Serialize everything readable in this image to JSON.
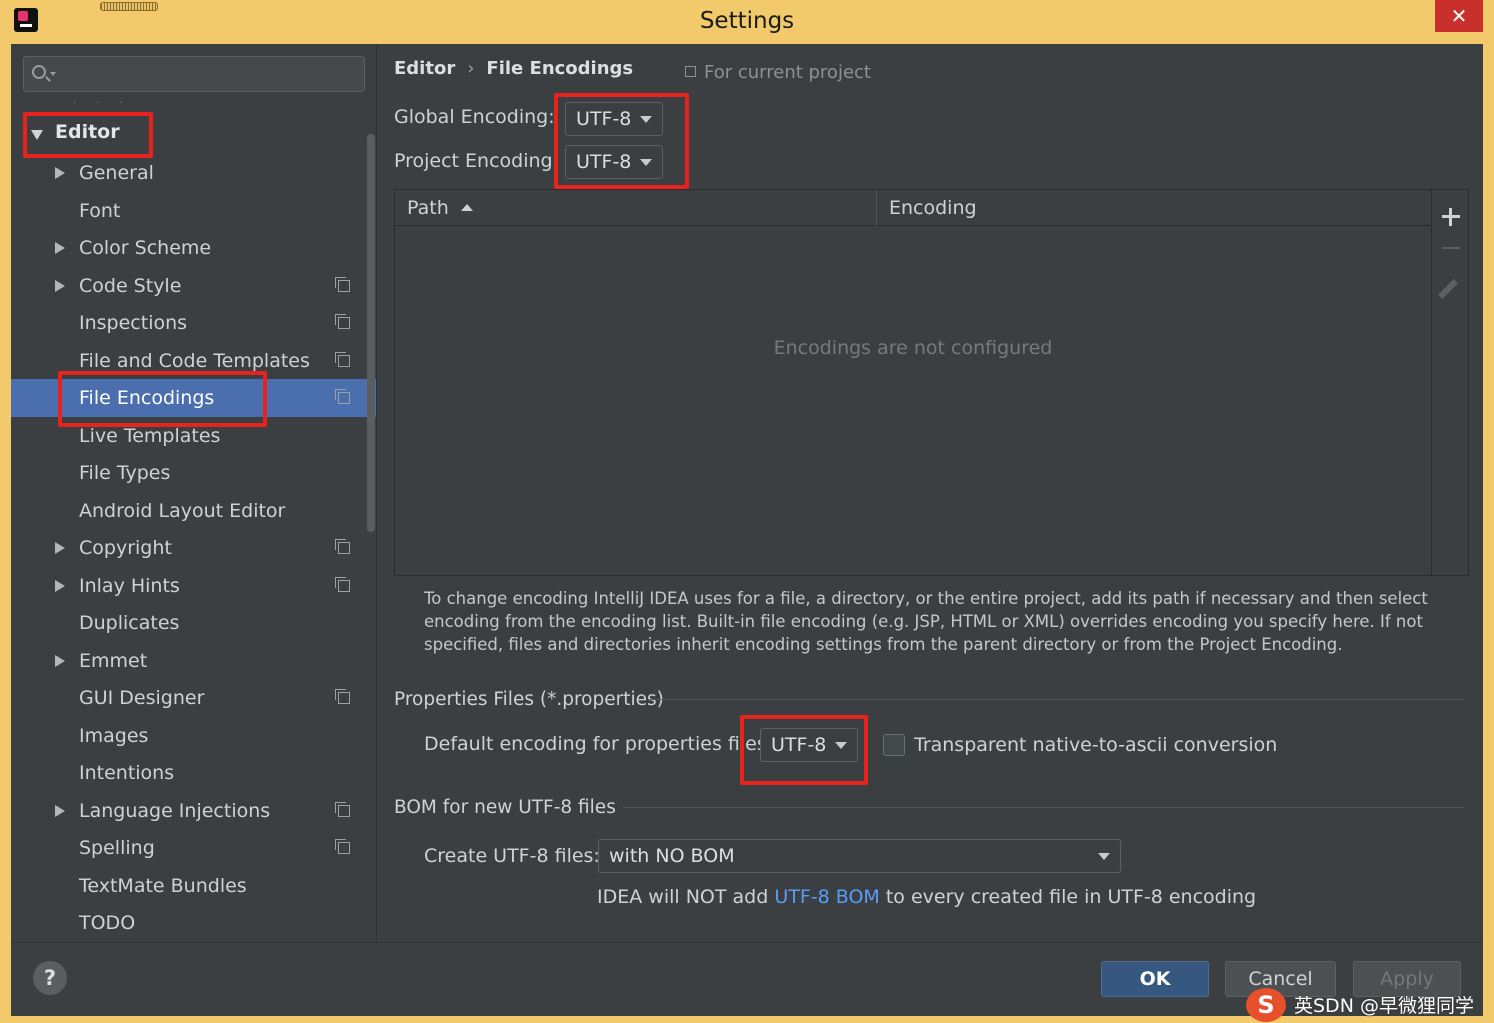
{
  "window": {
    "title": "Settings"
  },
  "sidebar": {
    "search": {
      "placeholder": ""
    },
    "editor_label": "Editor",
    "items": [
      {
        "label": "General",
        "expandable": true,
        "project": false
      },
      {
        "label": "Font",
        "expandable": false,
        "project": false
      },
      {
        "label": "Color Scheme",
        "expandable": true,
        "project": false
      },
      {
        "label": "Code Style",
        "expandable": true,
        "project": true
      },
      {
        "label": "Inspections",
        "expandable": false,
        "project": true
      },
      {
        "label": "File and Code Templates",
        "expandable": false,
        "project": true
      },
      {
        "label": "File Encodings",
        "expandable": false,
        "project": true,
        "selected": true
      },
      {
        "label": "Live Templates",
        "expandable": false,
        "project": false
      },
      {
        "label": "File Types",
        "expandable": false,
        "project": false
      },
      {
        "label": "Android Layout Editor",
        "expandable": false,
        "project": false
      },
      {
        "label": "Copyright",
        "expandable": true,
        "project": true
      },
      {
        "label": "Inlay Hints",
        "expandable": true,
        "project": true
      },
      {
        "label": "Duplicates",
        "expandable": false,
        "project": false
      },
      {
        "label": "Emmet",
        "expandable": true,
        "project": false
      },
      {
        "label": "GUI Designer",
        "expandable": false,
        "project": true
      },
      {
        "label": "Images",
        "expandable": false,
        "project": false
      },
      {
        "label": "Intentions",
        "expandable": false,
        "project": false
      },
      {
        "label": "Language Injections",
        "expandable": true,
        "project": true
      },
      {
        "label": "Spelling",
        "expandable": false,
        "project": true
      },
      {
        "label": "TextMate Bundles",
        "expandable": false,
        "project": false
      },
      {
        "label": "TODO",
        "expandable": false,
        "project": false
      }
    ]
  },
  "main": {
    "breadcrumb": {
      "parent": "Editor",
      "separator": "›",
      "current": "File Encodings"
    },
    "scope_note": "For current project",
    "global_encoding": {
      "label": "Global Encoding:",
      "value": "UTF-8"
    },
    "project_encoding": {
      "label": "Project Encoding:",
      "value": "UTF-8"
    },
    "table": {
      "columns": [
        "Path",
        "Encoding"
      ],
      "empty_text": "Encodings are not configured"
    },
    "help_text": "To change encoding IntelliJ IDEA uses for a file, a directory, or the entire project, add its path if necessary and then select encoding from the encoding list. Built-in file encoding (e.g. JSP, HTML or XML) overrides encoding you specify here. If not specified, files and directories inherit encoding settings from the parent directory or from the Project Encoding.",
    "properties": {
      "section_title": "Properties Files (*.properties)",
      "default_label": "Default encoding for properties files:",
      "default_value": "UTF-8",
      "transparent_label": "Transparent native-to-ascii conversion",
      "transparent_checked": false
    },
    "bom": {
      "section_title": "BOM for new UTF-8 files",
      "create_label": "Create UTF-8 files:",
      "create_value": "with NO BOM",
      "note_prefix": "IDEA will NOT add",
      "note_link": "UTF-8 BOM",
      "note_suffix": "to every created file in UTF-8 encoding"
    }
  },
  "footer": {
    "help": "?",
    "ok": "OK",
    "cancel": "Cancel",
    "apply": "Apply"
  },
  "watermark": {
    "logo": "S",
    "text": "英SDN @早微狸同学"
  },
  "colors": {
    "highlight": "#e8231f",
    "selection": "#4b6eaf",
    "link": "#589df6",
    "background": "#3c3f41"
  }
}
